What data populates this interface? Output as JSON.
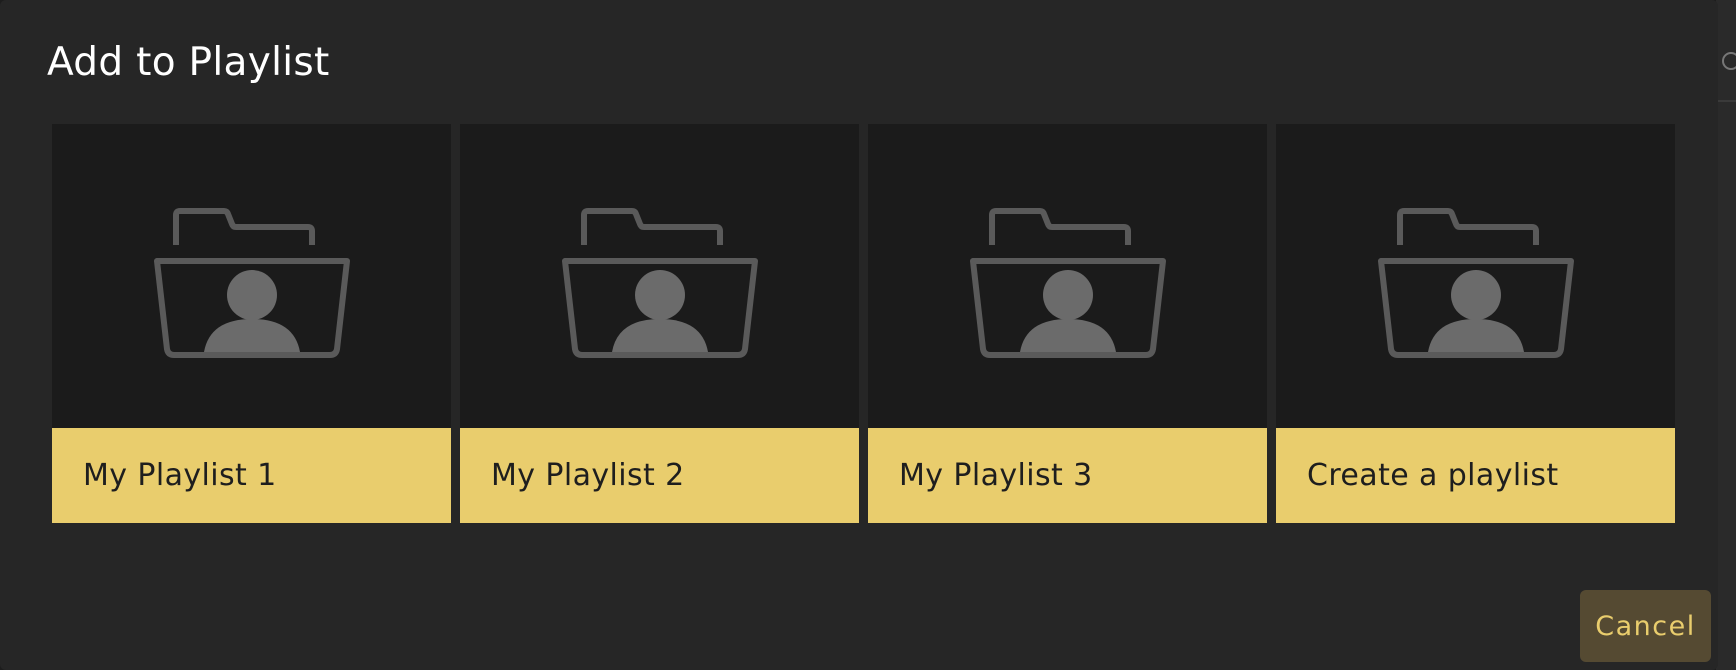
{
  "dialog": {
    "title": "Add to Playlist",
    "cancel_label": "Cancel"
  },
  "playlists": [
    {
      "label": "My Playlist 1",
      "icon": "folder-user-icon"
    },
    {
      "label": "My Playlist 2",
      "icon": "folder-user-icon"
    },
    {
      "label": "My Playlist 3",
      "icon": "folder-user-icon"
    },
    {
      "label": "Create a playlist",
      "icon": "folder-user-icon"
    }
  ],
  "colors": {
    "accent": "#e9cd6d",
    "dialog_bg": "#262626",
    "card_bg": "#1b1b1b",
    "icon": "#5a5a5a",
    "cancel_bg": "#554a32"
  }
}
